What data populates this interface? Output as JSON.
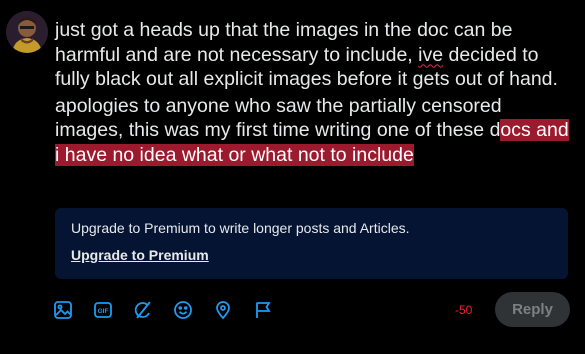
{
  "post": {
    "paragraph1": {
      "before": "just got a heads up that the images in the doc can be harmful and are not necessary to include, ",
      "misspelled": "ive",
      "after": " decided to fully black out all explicit images before it gets out of hand."
    },
    "paragraph2": {
      "before": "apologies to anyone who saw the partially censored images, this was my first time writing one of these d",
      "highlighted": "ocs and i have no idea what or what not to include"
    }
  },
  "premium_banner": {
    "text": "Upgrade to Premium to write longer posts and Articles.",
    "link_label": "Upgrade to Premium"
  },
  "toolbar": {
    "icons": [
      "image-icon",
      "gif-icon",
      "grok-icon",
      "emoji-icon",
      "location-icon",
      "flag-icon"
    ],
    "gif_label": "GIF"
  },
  "char_counter": "-50",
  "reply_button_label": "Reply",
  "colors": {
    "background": "#000000",
    "text": "#e7e9ea",
    "icon_blue": "#1d9bf0",
    "banner_bg": "#061433",
    "highlight": "#9c1a2e",
    "counter_red": "#f4212e",
    "reply_bg": "#2f3336"
  }
}
